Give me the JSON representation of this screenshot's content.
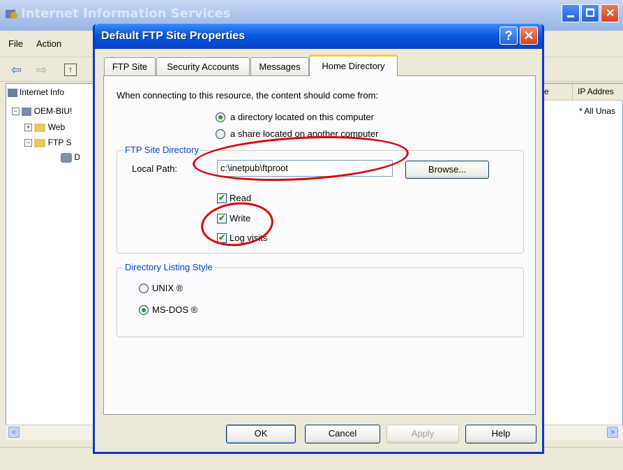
{
  "background_window": {
    "title": "Internet Information Services",
    "menu": [
      "File",
      "Action"
    ],
    "tree": {
      "root_label": "Internet Info",
      "computer_label": "OEM-BIU!",
      "web_label": "Web",
      "ftp_label": "FTP S",
      "site_label": "D"
    },
    "list_headers": [
      "e",
      "IP Addres"
    ],
    "list_cell": "* All Unas"
  },
  "dialog": {
    "title": "Default FTP Site Properties",
    "help_glyph": "?",
    "close_glyph": "✕",
    "tabs": [
      "FTP Site",
      "Security Accounts",
      "Messages",
      "Home Directory"
    ],
    "active_tab": "Home Directory",
    "content_source_prompt": "When connecting to this resource, the content should come from:",
    "source_options": [
      {
        "label": "a directory located on this computer",
        "selected": true
      },
      {
        "label": "a share located on another computer",
        "selected": false
      }
    ],
    "ftp_site_directory": {
      "legend": "FTP Site Directory",
      "local_path_label": "Local Path:",
      "local_path_value": "c:\\inetpub\\ftproot",
      "browse_label": "Browse...",
      "permissions": [
        {
          "label": "Read",
          "checked": true
        },
        {
          "label": "Write",
          "checked": true
        },
        {
          "label": "Log visits",
          "checked": true
        }
      ]
    },
    "directory_listing_style": {
      "legend": "Directory Listing Style",
      "options": [
        {
          "label": "UNIX ®",
          "selected": false
        },
        {
          "label": "MS-DOS ®",
          "selected": true
        }
      ]
    },
    "buttons": {
      "ok": "OK",
      "cancel": "Cancel",
      "apply": "Apply",
      "help": "Help"
    }
  },
  "colors": {
    "annotation_red": "#e00000",
    "xp_title_blue": "#0a5ae0"
  }
}
